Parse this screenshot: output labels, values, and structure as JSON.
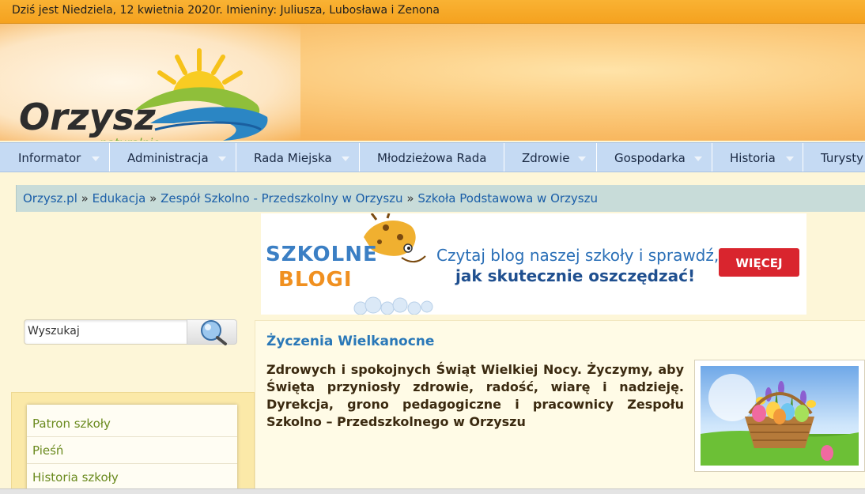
{
  "topbar": {
    "text": "Dziś jest Niedziela, 12 kwietnia 2020r. Imieniny: Juliusza, Lubosława i Zenona"
  },
  "logo": {
    "name": "Orzysz",
    "tagline": "naturalnie"
  },
  "nav": [
    {
      "label": "Informator",
      "has_dropdown": true
    },
    {
      "label": "Administracja",
      "has_dropdown": true
    },
    {
      "label": "Rada Miejska",
      "has_dropdown": true
    },
    {
      "label": "Młodzieżowa Rada",
      "has_dropdown": false
    },
    {
      "label": "Zdrowie",
      "has_dropdown": true
    },
    {
      "label": "Gospodarka",
      "has_dropdown": true
    },
    {
      "label": "Historia",
      "has_dropdown": true
    },
    {
      "label": "Turysty",
      "has_dropdown": false
    }
  ],
  "breadcrumb": {
    "items": [
      "Orzysz.pl",
      "Edukacja",
      "Zespół Szkolno - Przedszkolny w Orzyszu",
      "Szkoła Podstawowa w Orzyszu"
    ],
    "separator": "»"
  },
  "banner": {
    "brand_line1": "SZKOLNE",
    "brand_line2": "BLOGI",
    "text_line1": "Czytaj blog naszej szkoły i sprawdź,",
    "text_line2": "jak skutecznie oszczędzać!",
    "button": "WIĘCEJ"
  },
  "search": {
    "placeholder": "Wyszukaj",
    "button_icon": "magnifier-icon"
  },
  "sidemenu": [
    "Patron szkoły",
    "Pieśń",
    "Historia szkoły"
  ],
  "article": {
    "title": "Życzenia Wielkanocne",
    "body": "Zdrowych i spokojnych Świąt Wielkiej Nocy. Życzymy, aby Święta przyniosły zdrowie, radość, wiarę i nadzieję. Dyrekcja, grono pedagogiczne i pracownicy Zespołu Szkolno – Przedszkolnego w Orzyszu"
  },
  "colors": {
    "topbar": "#f7a923",
    "nav_bg": "#c5daf3",
    "link": "#1a5ea8",
    "title": "#2a78b8",
    "sidebar_link": "#6a8a1e"
  }
}
